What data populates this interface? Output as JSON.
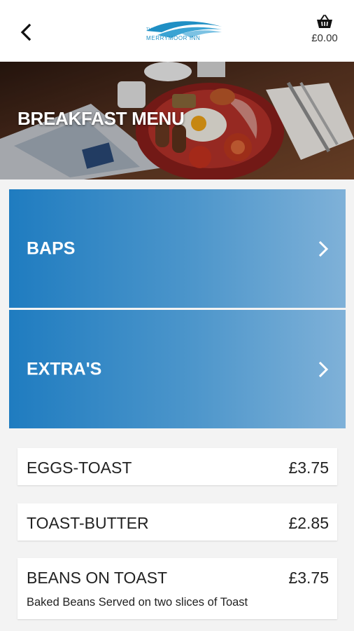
{
  "header": {
    "logo_small_text": "THE",
    "logo_text": "MERRYMOOR INN",
    "cart_total": "£0.00"
  },
  "hero": {
    "title": "BREAKFAST MENU"
  },
  "categories": [
    {
      "label": "BAPS"
    },
    {
      "label": "EXTRA'S"
    }
  ],
  "items": [
    {
      "name": "EGGS-TOAST",
      "price": "£3.75",
      "description": ""
    },
    {
      "name": "TOAST-BUTTER",
      "price": "£2.85",
      "description": ""
    },
    {
      "name": "BEANS ON TOAST",
      "price": "£3.75",
      "description": "Baked Beans Served on two slices of Toast"
    }
  ],
  "colors": {
    "accent": "#2a7fc0",
    "background": "#f3f3f3"
  }
}
